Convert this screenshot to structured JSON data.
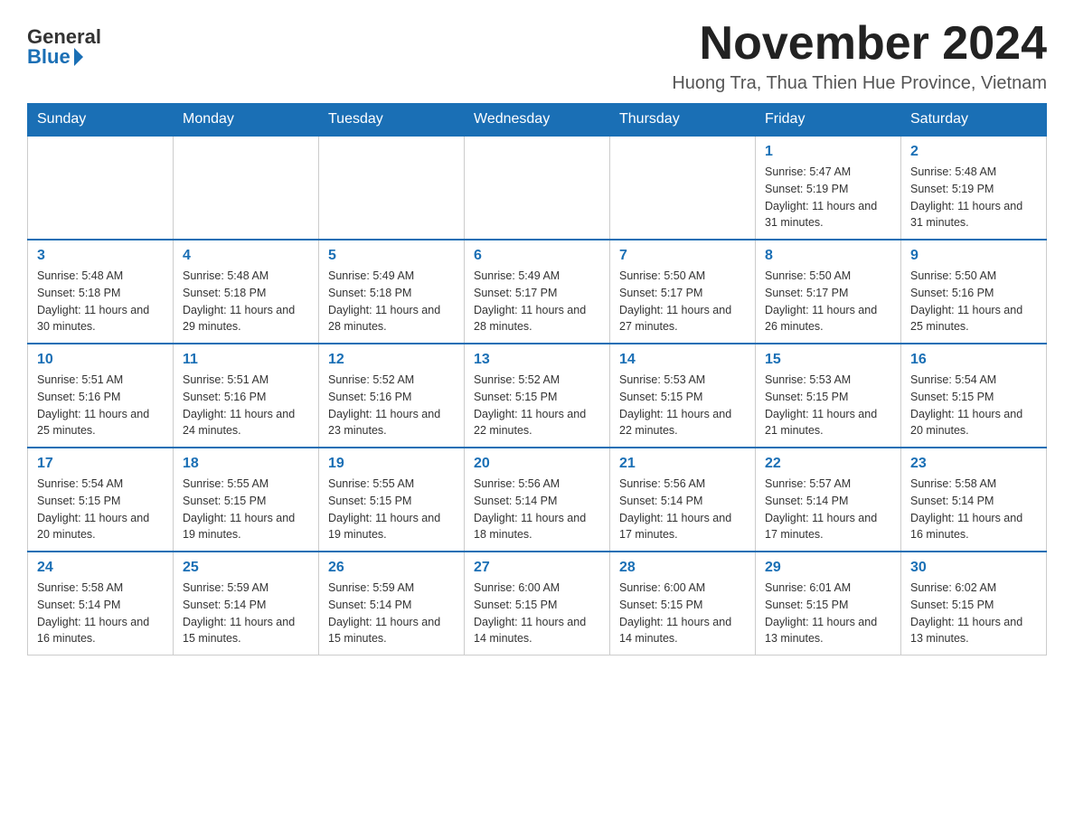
{
  "header": {
    "logo_general": "General",
    "logo_blue": "Blue",
    "month_title": "November 2024",
    "subtitle": "Huong Tra, Thua Thien Hue Province, Vietnam"
  },
  "weekdays": [
    "Sunday",
    "Monday",
    "Tuesday",
    "Wednesday",
    "Thursday",
    "Friday",
    "Saturday"
  ],
  "weeks": [
    [
      {
        "day": "",
        "info": ""
      },
      {
        "day": "",
        "info": ""
      },
      {
        "day": "",
        "info": ""
      },
      {
        "day": "",
        "info": ""
      },
      {
        "day": "",
        "info": ""
      },
      {
        "day": "1",
        "info": "Sunrise: 5:47 AM\nSunset: 5:19 PM\nDaylight: 11 hours and 31 minutes."
      },
      {
        "day": "2",
        "info": "Sunrise: 5:48 AM\nSunset: 5:19 PM\nDaylight: 11 hours and 31 minutes."
      }
    ],
    [
      {
        "day": "3",
        "info": "Sunrise: 5:48 AM\nSunset: 5:18 PM\nDaylight: 11 hours and 30 minutes."
      },
      {
        "day": "4",
        "info": "Sunrise: 5:48 AM\nSunset: 5:18 PM\nDaylight: 11 hours and 29 minutes."
      },
      {
        "day": "5",
        "info": "Sunrise: 5:49 AM\nSunset: 5:18 PM\nDaylight: 11 hours and 28 minutes."
      },
      {
        "day": "6",
        "info": "Sunrise: 5:49 AM\nSunset: 5:17 PM\nDaylight: 11 hours and 28 minutes."
      },
      {
        "day": "7",
        "info": "Sunrise: 5:50 AM\nSunset: 5:17 PM\nDaylight: 11 hours and 27 minutes."
      },
      {
        "day": "8",
        "info": "Sunrise: 5:50 AM\nSunset: 5:17 PM\nDaylight: 11 hours and 26 minutes."
      },
      {
        "day": "9",
        "info": "Sunrise: 5:50 AM\nSunset: 5:16 PM\nDaylight: 11 hours and 25 minutes."
      }
    ],
    [
      {
        "day": "10",
        "info": "Sunrise: 5:51 AM\nSunset: 5:16 PM\nDaylight: 11 hours and 25 minutes."
      },
      {
        "day": "11",
        "info": "Sunrise: 5:51 AM\nSunset: 5:16 PM\nDaylight: 11 hours and 24 minutes."
      },
      {
        "day": "12",
        "info": "Sunrise: 5:52 AM\nSunset: 5:16 PM\nDaylight: 11 hours and 23 minutes."
      },
      {
        "day": "13",
        "info": "Sunrise: 5:52 AM\nSunset: 5:15 PM\nDaylight: 11 hours and 22 minutes."
      },
      {
        "day": "14",
        "info": "Sunrise: 5:53 AM\nSunset: 5:15 PM\nDaylight: 11 hours and 22 minutes."
      },
      {
        "day": "15",
        "info": "Sunrise: 5:53 AM\nSunset: 5:15 PM\nDaylight: 11 hours and 21 minutes."
      },
      {
        "day": "16",
        "info": "Sunrise: 5:54 AM\nSunset: 5:15 PM\nDaylight: 11 hours and 20 minutes."
      }
    ],
    [
      {
        "day": "17",
        "info": "Sunrise: 5:54 AM\nSunset: 5:15 PM\nDaylight: 11 hours and 20 minutes."
      },
      {
        "day": "18",
        "info": "Sunrise: 5:55 AM\nSunset: 5:15 PM\nDaylight: 11 hours and 19 minutes."
      },
      {
        "day": "19",
        "info": "Sunrise: 5:55 AM\nSunset: 5:15 PM\nDaylight: 11 hours and 19 minutes."
      },
      {
        "day": "20",
        "info": "Sunrise: 5:56 AM\nSunset: 5:14 PM\nDaylight: 11 hours and 18 minutes."
      },
      {
        "day": "21",
        "info": "Sunrise: 5:56 AM\nSunset: 5:14 PM\nDaylight: 11 hours and 17 minutes."
      },
      {
        "day": "22",
        "info": "Sunrise: 5:57 AM\nSunset: 5:14 PM\nDaylight: 11 hours and 17 minutes."
      },
      {
        "day": "23",
        "info": "Sunrise: 5:58 AM\nSunset: 5:14 PM\nDaylight: 11 hours and 16 minutes."
      }
    ],
    [
      {
        "day": "24",
        "info": "Sunrise: 5:58 AM\nSunset: 5:14 PM\nDaylight: 11 hours and 16 minutes."
      },
      {
        "day": "25",
        "info": "Sunrise: 5:59 AM\nSunset: 5:14 PM\nDaylight: 11 hours and 15 minutes."
      },
      {
        "day": "26",
        "info": "Sunrise: 5:59 AM\nSunset: 5:14 PM\nDaylight: 11 hours and 15 minutes."
      },
      {
        "day": "27",
        "info": "Sunrise: 6:00 AM\nSunset: 5:15 PM\nDaylight: 11 hours and 14 minutes."
      },
      {
        "day": "28",
        "info": "Sunrise: 6:00 AM\nSunset: 5:15 PM\nDaylight: 11 hours and 14 minutes."
      },
      {
        "day": "29",
        "info": "Sunrise: 6:01 AM\nSunset: 5:15 PM\nDaylight: 11 hours and 13 minutes."
      },
      {
        "day": "30",
        "info": "Sunrise: 6:02 AM\nSunset: 5:15 PM\nDaylight: 11 hours and 13 minutes."
      }
    ]
  ]
}
